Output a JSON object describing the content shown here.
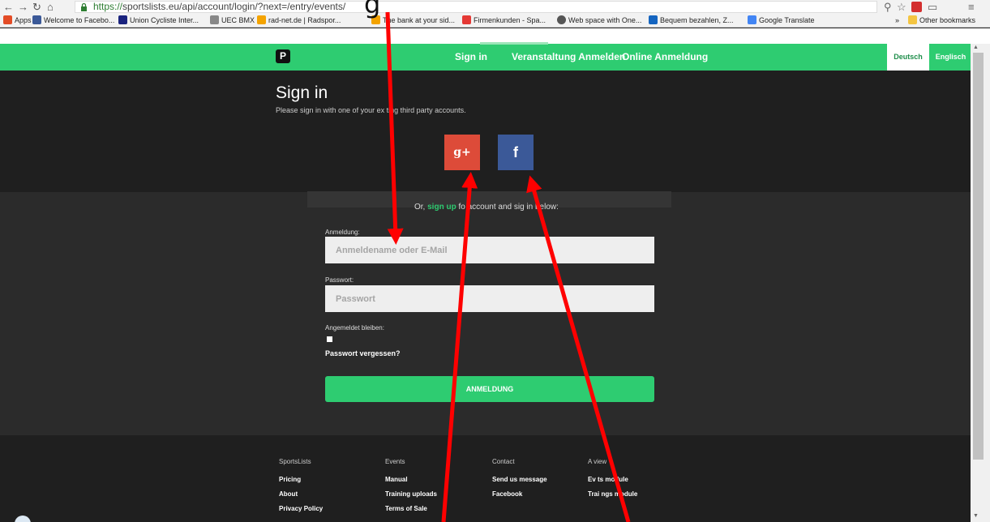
{
  "browser": {
    "url_secure": "https://",
    "url_rest": "sportslists.eu/api/account/login/?next=/entry/events/",
    "bookmarks": [
      {
        "label": "Apps",
        "color": "#e34c26"
      },
      {
        "label": "Welcome to Facebo...",
        "color": "#3b5998"
      },
      {
        "label": "Union Cycliste Inter...",
        "color": "#1a237e"
      },
      {
        "label": "UEC BMX",
        "color": "#888888"
      },
      {
        "label": "rad-net.de | Radspor...",
        "color": "#f4a300"
      },
      {
        "label": "The bank at your sid...",
        "color": "#f4a300"
      },
      {
        "label": "Firmenkunden - Spa...",
        "color": "#e53935"
      },
      {
        "label": "Web space with One...",
        "color": "#555555"
      },
      {
        "label": "Bequem bezahlen, Z...",
        "color": "#1565c0"
      },
      {
        "label": "Google Translate",
        "color": "#4285f4"
      }
    ],
    "other_bookmarks": "Other bookmarks",
    "chevrons": "»"
  },
  "annotation": {
    "text": "g"
  },
  "nav": {
    "logo": "P",
    "links": [
      "Sign in",
      "Veranstaltung Anmelden",
      "Online Anmeldung"
    ],
    "lang_active": "Deutsch",
    "lang_other": "Englisch"
  },
  "hero": {
    "title": "Sign in",
    "subtitle": "Please sign in with one of your ex  ting third party accounts.",
    "google_label": "g+",
    "facebook_label": "f"
  },
  "form": {
    "or_prefix": "Or, ",
    "or_link": "sign up",
    "or_suffix": " fo    account and sig   in below:",
    "username_label": "Anmeldung:",
    "username_placeholder": "Anmeldename oder E-Mail",
    "password_label": "Passwort:",
    "password_placeholder": "Passwort",
    "remember_label": "Angemeldet bleiben:",
    "forgot": "Passwort vergessen?",
    "submit": "ANMELDUNG"
  },
  "footer": {
    "columns": [
      {
        "title": "SportsLists",
        "links": [
          "Pricing",
          "About",
          "Privacy Policy"
        ]
      },
      {
        "title": "Events",
        "links": [
          "Manual",
          "Training uploads",
          "Terms of Sale"
        ]
      },
      {
        "title": "Contact",
        "links": [
          "Send us message",
          "Facebook"
        ]
      },
      {
        "title": "A    view",
        "links": [
          "Ev    ts module",
          "Trai   ngs module"
        ]
      }
    ]
  },
  "colors": {
    "green": "#2ecc71",
    "dark": "#1f1f1f",
    "arrow": "#ff0000"
  }
}
